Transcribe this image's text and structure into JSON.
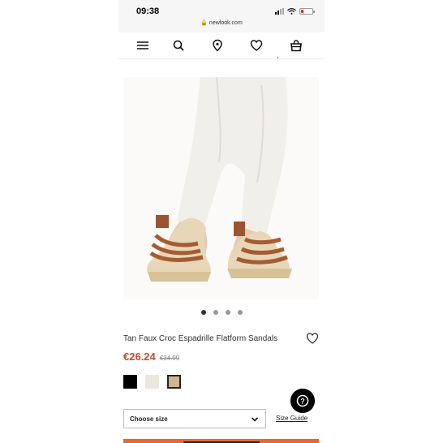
{
  "status_bar": {
    "time": "09:38",
    "url": "newlook.com"
  },
  "nav": {
    "icons": [
      "menu-icon",
      "search-icon",
      "store-locator-icon",
      "wishlist-icon",
      "bag-icon"
    ]
  },
  "product": {
    "image_alt": "Tan sandals",
    "title": "Tan Faux Croc Espadrille Flatform Sandals",
    "price": "€26.24",
    "was_price": "€34.99",
    "carousel": {
      "count": 4,
      "active_index": 0
    },
    "swatches": [
      {
        "name": "black",
        "color": "#000000",
        "selected": false
      },
      {
        "name": "cream",
        "color": "#ede6dc",
        "selected": false
      },
      {
        "name": "tan",
        "color": "#cfb48f",
        "selected": true
      }
    ],
    "size_select_label": "Choose size",
    "size_guide_label": "Size Guide"
  },
  "colors": {
    "accent_price": "#c44a2c",
    "add_bag": "#e46a2f"
  }
}
